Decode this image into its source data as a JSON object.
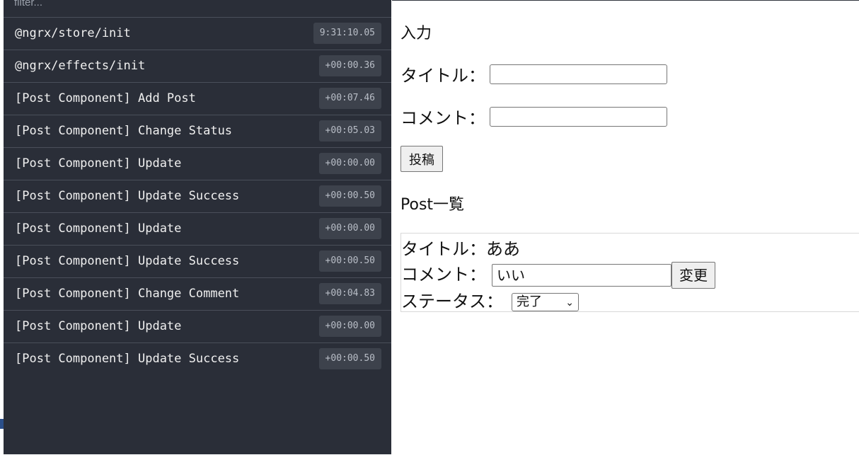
{
  "devtools": {
    "filter_placeholder": "filter...",
    "actions": [
      {
        "name": "@ngrx/store/init",
        "time": "9:31:10.05"
      },
      {
        "name": "@ngrx/effects/init",
        "time": "+00:00.36"
      },
      {
        "name": "[Post Component] Add Post",
        "time": "+00:07.46"
      },
      {
        "name": "[Post Component] Change Status",
        "time": "+00:05.03"
      },
      {
        "name": "[Post Component] Update",
        "time": "+00:00.00"
      },
      {
        "name": "[Post Component] Update Success",
        "time": "+00:00.50"
      },
      {
        "name": "[Post Component] Update",
        "time": "+00:00.00"
      },
      {
        "name": "[Post Component] Update Success",
        "time": "+00:00.50"
      },
      {
        "name": "[Post Component] Change Comment",
        "time": "+00:04.83"
      },
      {
        "name": "[Post Component] Update",
        "time": "+00:00.00"
      },
      {
        "name": "[Post Component] Update Success",
        "time": "+00:00.50"
      }
    ]
  },
  "app": {
    "input_heading": "入力",
    "title_label": "タイトル：",
    "title_value": "",
    "comment_label": "コメント：",
    "comment_value": "",
    "post_button": "投稿",
    "list_heading": "Post一覧",
    "post": {
      "title_label": "タイトル：",
      "title_value": "ああ",
      "comment_label": "コメント：",
      "comment_value": "いい",
      "change_button": "変更",
      "status_label": "ステータス：",
      "status_value": "完了"
    }
  },
  "colors": {
    "devtools_bg": "#2a2e38",
    "time_badge_bg": "#3d424c",
    "app_bg": "#ffffff"
  },
  "icons": {
    "select_chevron": "chevron-down-icon"
  }
}
